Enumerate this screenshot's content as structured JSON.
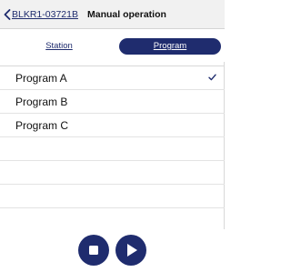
{
  "header": {
    "back_icon": "chevron-left-icon",
    "device_id": "BLKR1-03721B",
    "title": "Manual operation"
  },
  "segment": {
    "station_label": "Station",
    "program_label": "Program",
    "selected": "Program"
  },
  "programs": [
    {
      "label": "Program A",
      "selected": true
    },
    {
      "label": "Program B",
      "selected": false
    },
    {
      "label": "Program C",
      "selected": false
    }
  ],
  "controls": {
    "stop_icon": "stop-icon",
    "play_icon": "play-icon"
  },
  "colors": {
    "accent": "#1f2c6e",
    "nav_background": "#f1f1f1",
    "checkmark": "#1f2c6e"
  }
}
